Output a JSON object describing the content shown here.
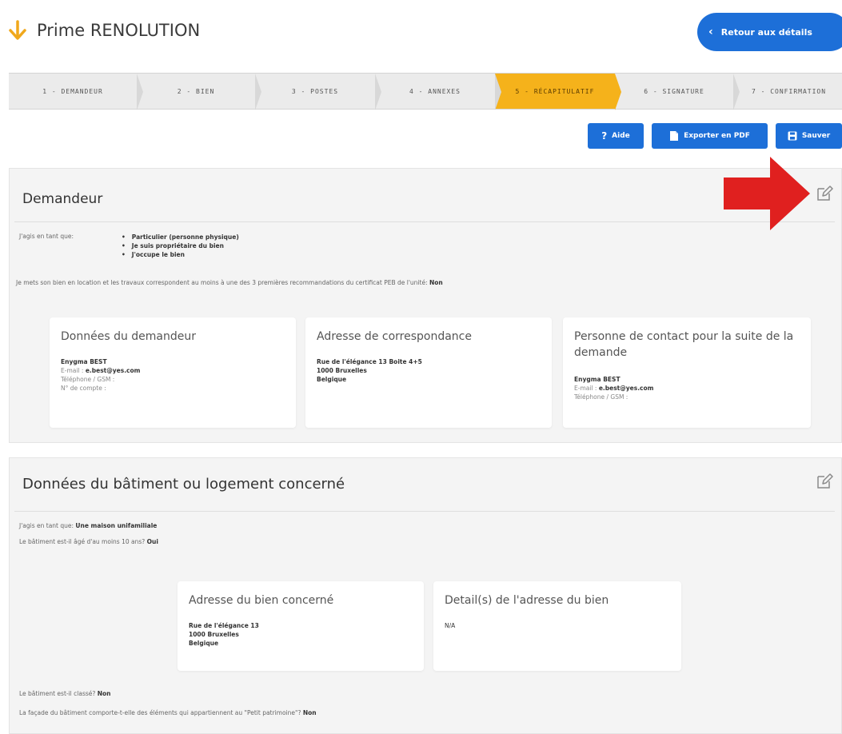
{
  "header": {
    "title": "Prime RENOLUTION",
    "back_label": "Retour aux détails"
  },
  "stepper": {
    "steps": [
      {
        "label": "1 - DEMANDEUR",
        "active": false
      },
      {
        "label": "2 - BIEN",
        "active": false
      },
      {
        "label": "3 - POSTES",
        "active": false
      },
      {
        "label": "4 - ANNEXES",
        "active": false
      },
      {
        "label": "5 - RÉCAPITULATIF",
        "active": true
      },
      {
        "label": "6 - SIGNATURE",
        "active": false
      },
      {
        "label": "7 - CONFIRMATION",
        "active": false
      }
    ]
  },
  "actions": {
    "help_label": "Aide",
    "pdf_label": "Exporter en PDF",
    "save_label": "Sauver"
  },
  "colors": {
    "primary": "#1d6fd8",
    "active_step": "#f5b21b",
    "arrow_red": "#e0201f",
    "title_arrow": "#f0a81c"
  },
  "demandeur": {
    "title": "Demandeur",
    "acting_as_label": "J'agis en tant que:",
    "acting_as": [
      "Particulier (personne physique)",
      "Je suis propriétaire du bien",
      "J'occupe le bien"
    ],
    "rental_question": "Je mets son bien en location et les travaux correspondent au moins à une des 3 premières recommandations du certificat PEB de l'unité:",
    "rental_answer": "Non",
    "cards": {
      "applicant": {
        "title": "Données du demandeur",
        "name": "Enygma BEST",
        "email_label": "E-mail :",
        "email": "e.best@yes.com",
        "phone_label": "Téléphone / GSM :",
        "account_label": "N° de compte :"
      },
      "correspondence": {
        "title": "Adresse de correspondance",
        "line1": "Rue de l'élégance 13 Boite 4+5",
        "line2": "1000 Bruxelles",
        "line3": "Belgique"
      },
      "contact": {
        "title": "Personne de contact pour la suite de la demande",
        "name": "Enygma BEST",
        "email_label": "E-mail :",
        "email": "e.best@yes.com",
        "phone_label": "Téléphone / GSM :"
      }
    }
  },
  "batiment": {
    "title": "Données du bâtiment ou logement concerné",
    "acting_as_label": "J'agis en tant que:",
    "acting_as": "Une maison unifamiliale",
    "age_question": "Le bâtiment est-il âgé d'au moins 10 ans?",
    "age_answer": "Oui",
    "cards": {
      "address": {
        "title": "Adresse du bien concerné",
        "line1": "Rue de l'élégance 13",
        "line2": "1000 Bruxelles",
        "line3": "Belgique"
      },
      "details": {
        "title": "Detail(s) de l'adresse du bien",
        "value": "N/A"
      }
    },
    "classified_question": "Le bâtiment est-il classé?",
    "classified_answer": "Non",
    "heritage_question": "La façade du bâtiment comporte-t-elle des éléments qui appartiennent au \"Petit patrimoine\"?",
    "heritage_answer": "Non"
  }
}
